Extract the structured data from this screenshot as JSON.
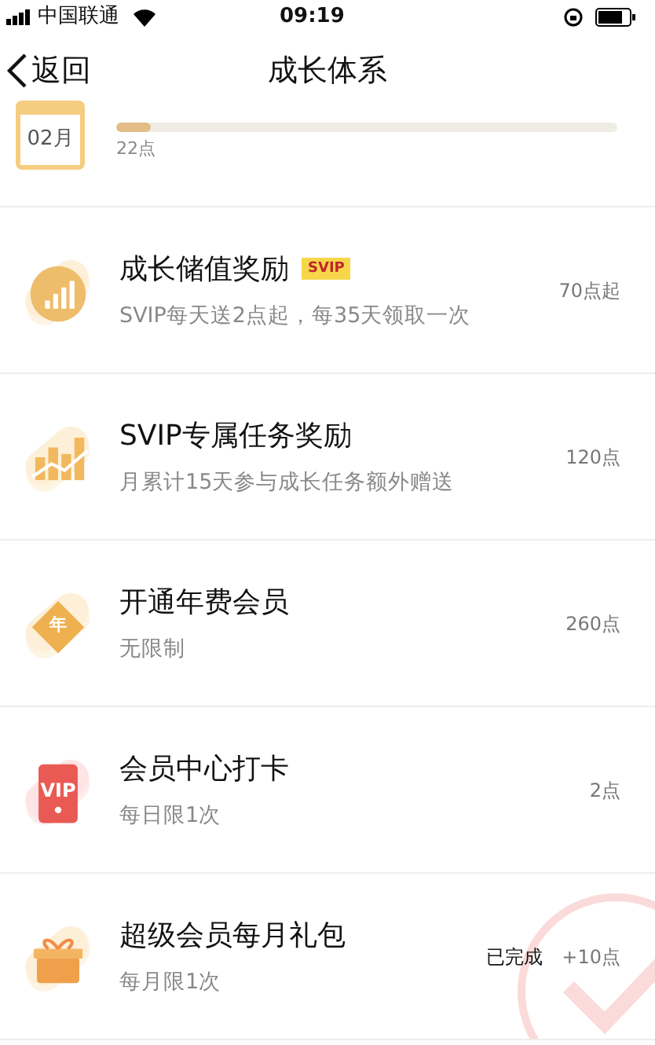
{
  "status_bar": {
    "carrier": "中国联通",
    "time": "09:19"
  },
  "nav": {
    "back": "返回",
    "title": "成长体系"
  },
  "month_progress": {
    "month": "02月",
    "level": 0.07,
    "points": "22点"
  },
  "tasks": [
    {
      "kind": "chart",
      "title": "成长储值奖励",
      "badge": "SVIP",
      "subtitle": "SVIP每天送2点起，每35天领取一次",
      "points": "70点起",
      "completed": false
    },
    {
      "kind": "trend",
      "title": "SVIP专属任务奖励",
      "subtitle": "月累计15天参与成长任务额外赠送",
      "points": "120点",
      "completed": false
    },
    {
      "kind": "diamond",
      "icon_text": "年",
      "title": "开通年费会员",
      "subtitle": "无限制",
      "points": "260点",
      "completed": false
    },
    {
      "kind": "vip",
      "icon_text": "VIP",
      "title": "会员中心打卡",
      "subtitle": "每日限1次",
      "points": "2点",
      "completed": false
    },
    {
      "kind": "gift",
      "title": "超级会员每月礼包",
      "subtitle": "每月限1次",
      "status": "已完成",
      "points": "+10点",
      "completed": true
    }
  ]
}
